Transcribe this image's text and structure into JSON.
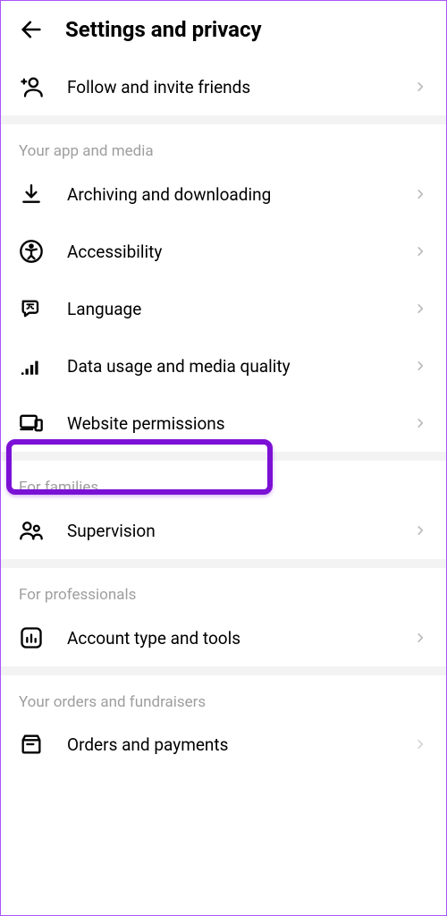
{
  "header": {
    "title": "Settings and privacy"
  },
  "top": {
    "follow": "Follow and invite friends"
  },
  "sections": {
    "app_media": {
      "title": "Your app and media",
      "archiving": "Archiving and downloading",
      "accessibility": "Accessibility",
      "language": "Language",
      "data_usage": "Data usage and media quality",
      "website_perm": "Website permissions"
    },
    "families": {
      "title": "For families",
      "supervision": "Supervision"
    },
    "professionals": {
      "title": "For professionals",
      "account_type": "Account type and tools"
    },
    "orders": {
      "title": "Your orders and fundraisers",
      "orders_payments": "Orders and payments"
    }
  }
}
